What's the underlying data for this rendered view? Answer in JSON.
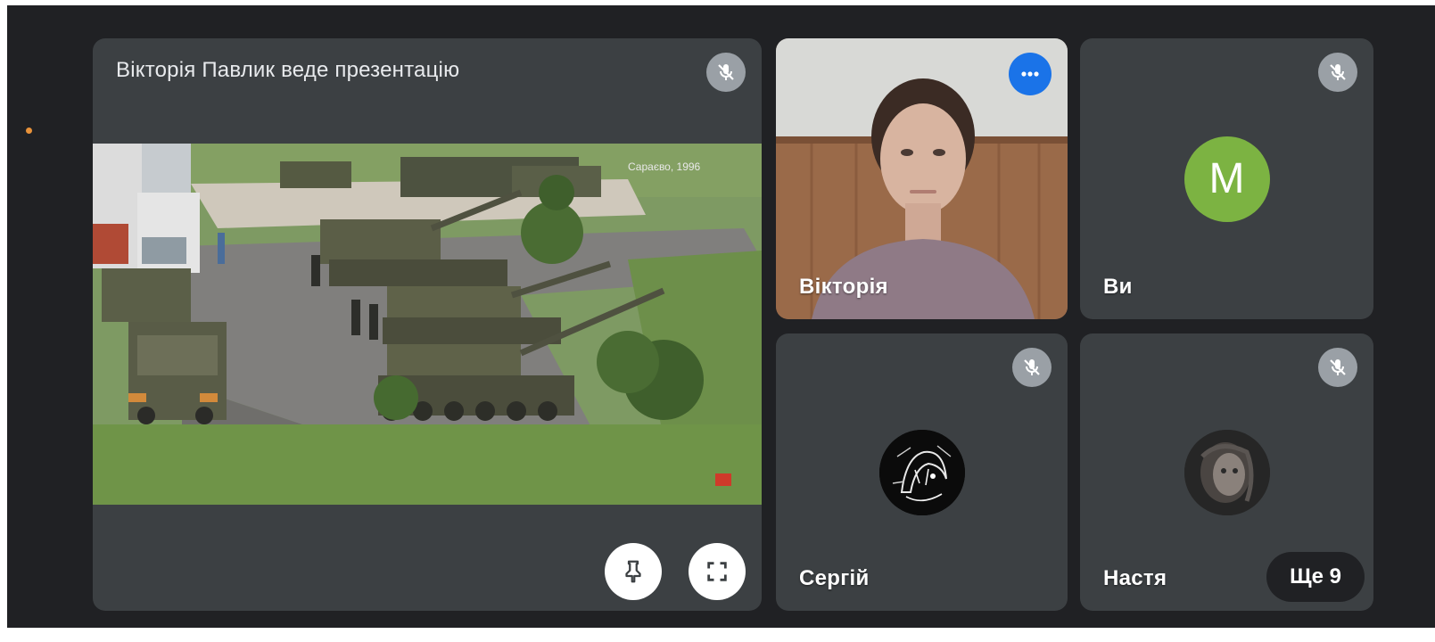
{
  "presentation": {
    "title": "Вікторія Павлик веде презентацію",
    "screen_caption": "Сараєво, 1996",
    "mic_icon": "mic-off-icon",
    "controls": {
      "pin_icon": "pin-icon",
      "fullscreen_icon": "fullscreen-icon"
    }
  },
  "participants": [
    {
      "name": "Вікторія",
      "video": "camera-on",
      "control_icon": "more-options-icon"
    },
    {
      "name": "Ви",
      "avatar_letter": "M",
      "avatar_color": "#7cb342",
      "mic_icon": "mic-off-icon"
    },
    {
      "name": "Сергій",
      "avatar": "photo",
      "mic_icon": "mic-off-icon"
    },
    {
      "name": "Настя",
      "avatar": "photo",
      "mic_icon": "mic-off-icon"
    }
  ],
  "overflow": {
    "label": "Ще 9"
  },
  "colors": {
    "background": "#202124",
    "tile": "#3c4043",
    "accent": "#1a73e8",
    "mic_off_badge": "#9aa0a6"
  }
}
